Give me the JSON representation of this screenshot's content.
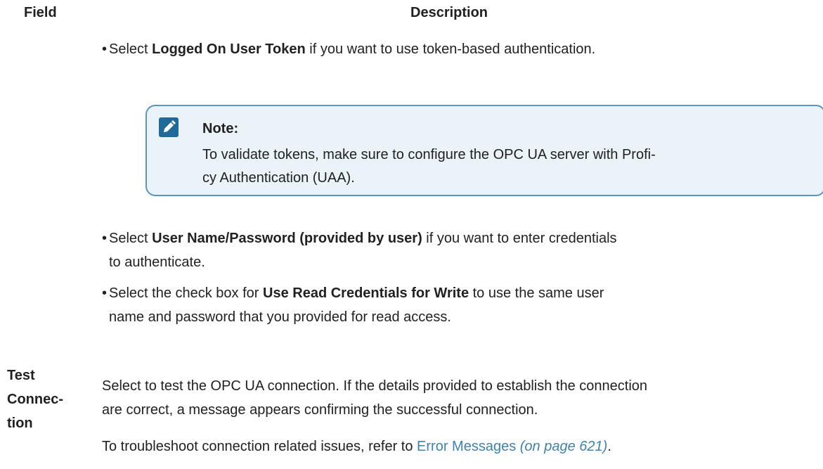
{
  "table_header": {
    "field": "Field",
    "description": "Description"
  },
  "bullets": [
    {
      "prefix": "Select ",
      "bold": "Logged On User Token",
      "suffix": " if you want to use token-based authentication."
    },
    {
      "prefix": "Select ",
      "bold": "User Name/Password (provided by user)",
      "suffix": " if you want to enter credentials",
      "line2": "to authenticate."
    },
    {
      "prefix": "Select the check box for ",
      "bold": "Use Read Credentials for Write",
      "suffix": " to use the same user",
      "line2": "name and password that you provided for read access."
    }
  ],
  "note": {
    "icon": "pencil-note-icon",
    "title": "Note:",
    "line1": "To validate tokens, make sure to configure the OPC UA server with Profi-",
    "line2": "cy Authentication (UAA)."
  },
  "test_connection": {
    "label_lines": [
      "Test",
      "Connec-",
      "tion"
    ],
    "para1_line1": "Select to test the OPC UA connection. If the details provided to establish the connection",
    "para1_line2": "are correct, a message appears confirming the successful connection.",
    "para2_prefix": "To troubleshoot connection related issues, refer to ",
    "link_text": "Error Messages",
    "page_ref": "(on page 621)",
    "para2_suffix": "."
  },
  "colors": {
    "link": "#3d84ad",
    "note_border": "#5b95bd",
    "note_bg": "#eaf3f7",
    "icon_bg": "#1f6a98"
  }
}
